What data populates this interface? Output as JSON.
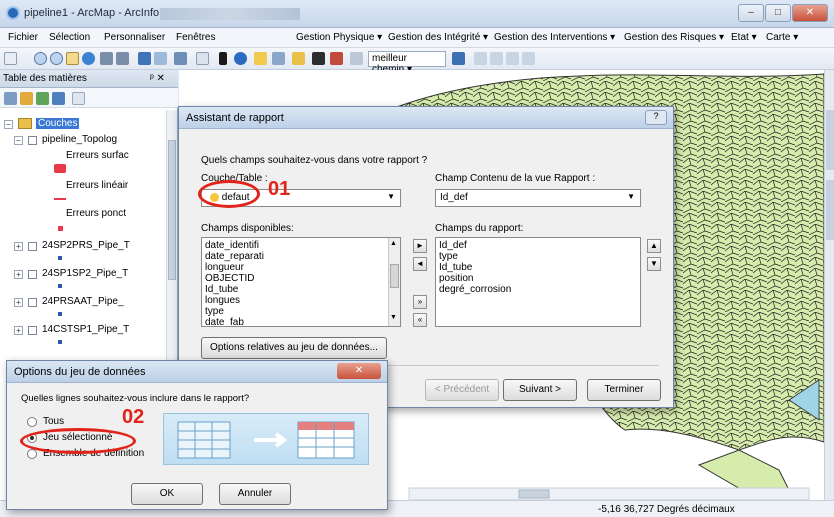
{
  "window": {
    "title": "pipeline1 - ArcMap - ArcInfo",
    "btn_min": "–",
    "btn_max": "□",
    "btn_close": "✕"
  },
  "menu": {
    "left": [
      "Fichier",
      "Sélection",
      "Personnaliser",
      "Fenêtres"
    ],
    "right": [
      "Gestion Physique ▾",
      "Gestion des Intégrité ▾",
      "Gestion des Interventions ▾",
      "Gestion des Risques ▾",
      "Etat ▾",
      "Carte ▾"
    ]
  },
  "toolbar": {
    "route_combo": "meilleur chemin ▾"
  },
  "toc": {
    "title": "Table des matières",
    "pin": "ᵖ ✕",
    "root": "Couches",
    "layers": [
      {
        "name": "pipeline_Topolog",
        "sub": [
          "Erreurs surfac",
          "Erreurs linéair",
          "Erreurs ponct"
        ]
      },
      {
        "name": "24SP2PRS_Pipe_T"
      },
      {
        "name": "24SP1SP2_Pipe_T"
      },
      {
        "name": "24PRSAAT_Pipe_"
      },
      {
        "name": "14CSTSP1_Pipe_T"
      }
    ]
  },
  "status": {
    "coords": "-5,16 36,727 Degrés décimaux"
  },
  "assistant": {
    "title": "Assistant de rapport",
    "question": "Quels champs souhaitez-vous dans votre rapport ?",
    "layer_label": "Couche/Table :",
    "layer_value": "defaut",
    "view_label": "Champ Contenu de la vue Rapport :",
    "view_value": "Id_def",
    "available_label": "Champs disponibles:",
    "available": [
      "date_identifi",
      "date_reparati",
      "longueur",
      "OBJECTID",
      "Id_tube",
      "longues",
      "type",
      "date_fab"
    ],
    "report_label": "Champs du rapport:",
    "report": [
      "Id_def",
      "type",
      "Id_tube",
      "position",
      "degré_corrosion"
    ],
    "options_btn": "Options relatives au jeu de données...",
    "prev_btn": "< Précédent",
    "next_btn": "Suivant >",
    "finish_btn": "Terminer",
    "help": "?"
  },
  "options": {
    "title": "Options du jeu de données",
    "question": "Quelles lignes souhaitez-vous inclure dans le rapport?",
    "radios": [
      "Tous",
      "Jeu sélectionné",
      "Ensemble de définition"
    ],
    "selected_index": 1,
    "ok": "OK",
    "cancel": "Annuler"
  },
  "annotations": {
    "label1": "01",
    "label2": "02"
  }
}
